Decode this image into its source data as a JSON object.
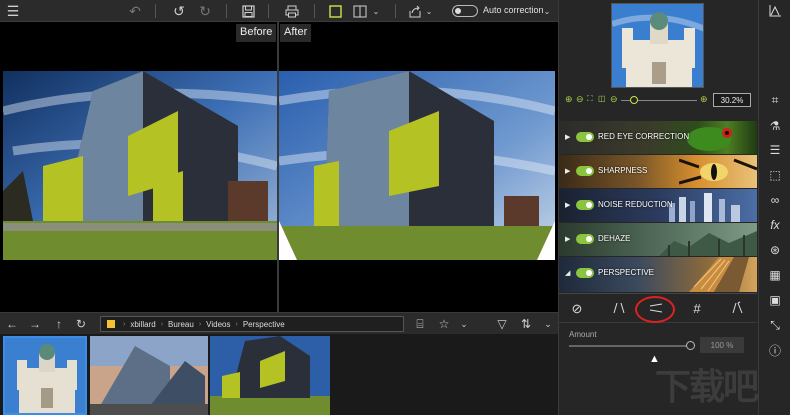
{
  "toolbar": {
    "auto_correction_label": "Auto correction"
  },
  "compare": {
    "before_label": "Before",
    "after_label": "After"
  },
  "path": {
    "crumbs": [
      "xbillard",
      "Bureau",
      "Videos",
      "Perspective"
    ]
  },
  "zoom": {
    "value": "30.2%"
  },
  "effects": [
    {
      "label": "RED EYE CORRECTION",
      "enabled": true
    },
    {
      "label": "SHARPNESS",
      "enabled": true
    },
    {
      "label": "NOISE REDUCTION",
      "enabled": true
    },
    {
      "label": "DEHAZE",
      "enabled": true
    },
    {
      "label": "PERSPECTIVE",
      "enabled": true
    }
  ],
  "perspective": {
    "amount_label": "Amount",
    "amount_value": "100 %"
  },
  "colors": {
    "accent_green": "#8bc53f",
    "highlight_red": "#dd2222"
  }
}
